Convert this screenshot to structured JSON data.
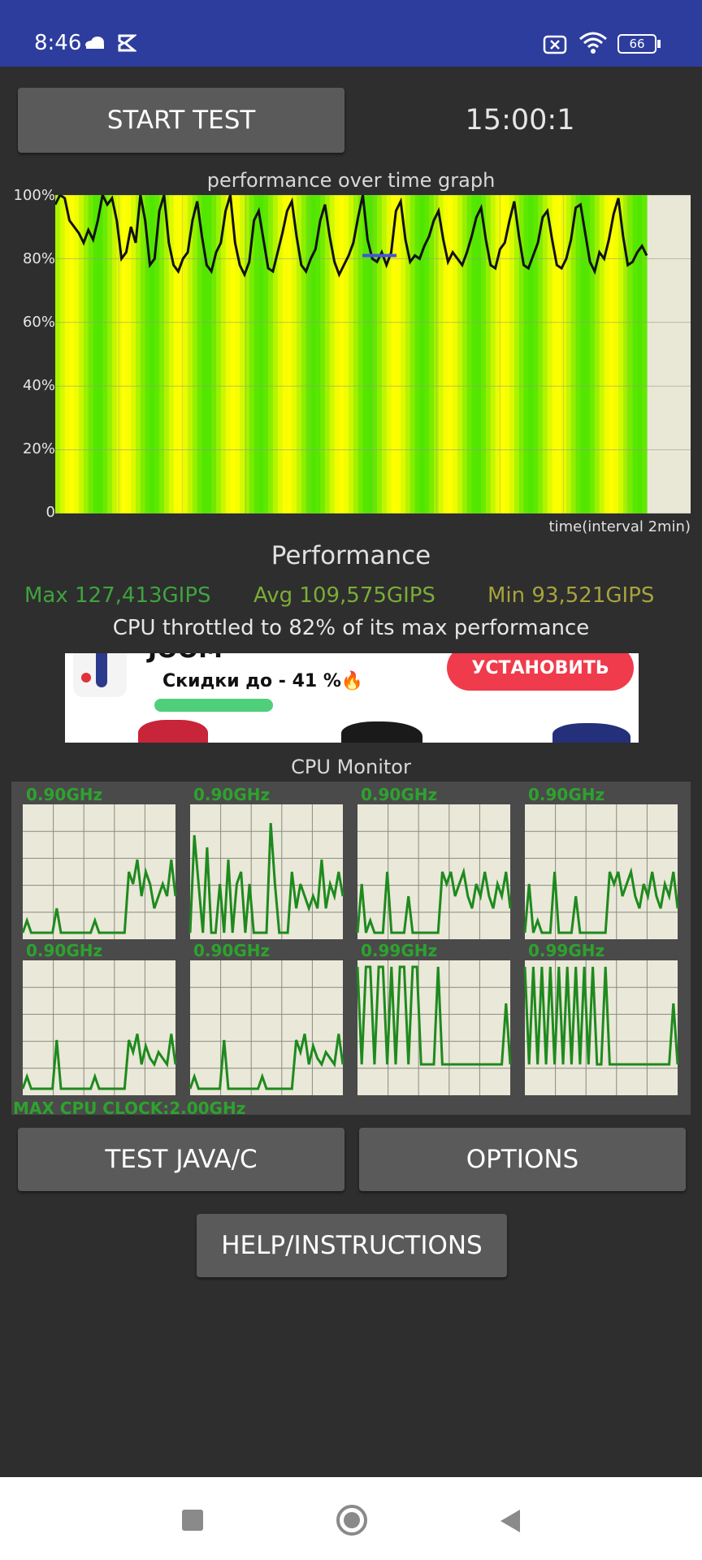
{
  "status_bar": {
    "time": "8:46",
    "battery": "66",
    "icons": [
      "cloud-icon",
      "k-app-icon",
      "sim-off-icon",
      "wifi-icon",
      "battery-icon"
    ]
  },
  "toolbar": {
    "start_label": "START TEST",
    "timer": "15:00:1"
  },
  "perf_graph": {
    "title": "performance over time graph",
    "xlabel": "time(interval 2min)",
    "y_ticks": [
      "100%",
      "80%",
      "60%",
      "40%",
      "20%",
      "0"
    ]
  },
  "chart_data": {
    "type": "line",
    "title": "performance over time graph",
    "xlabel": "time(interval 2min)",
    "ylabel": "",
    "ylim": [
      0,
      100
    ],
    "y_ticks": [
      "0",
      "20%",
      "40%",
      "60%",
      "80%",
      "100%"
    ],
    "grid": true,
    "series": [
      {
        "values": [
          97,
          100,
          99,
          92,
          90,
          88,
          85,
          89,
          86,
          92,
          100,
          97,
          99,
          92,
          80,
          82,
          90,
          85,
          100,
          92,
          78,
          80,
          95,
          100,
          85,
          78,
          76,
          80,
          82,
          92,
          98,
          87,
          78,
          76,
          82,
          85,
          95,
          100,
          85,
          78,
          75,
          79,
          92,
          95,
          86,
          77,
          76,
          82,
          88,
          95,
          98,
          87,
          78,
          76,
          80,
          83,
          92,
          97,
          87,
          79,
          75,
          78,
          81,
          85,
          93,
          100,
          86,
          80,
          79,
          82,
          78,
          82,
          95,
          98,
          86,
          79,
          81,
          80,
          84,
          87,
          92,
          95,
          86,
          79,
          82,
          80,
          78,
          82,
          87,
          93,
          96,
          86,
          78,
          77,
          83,
          85,
          92,
          98,
          87,
          78,
          77,
          81,
          85,
          93,
          95,
          86,
          78,
          77,
          80,
          86,
          96,
          97,
          88,
          79,
          76,
          82,
          80,
          86,
          94,
          99,
          87,
          78,
          79,
          82,
          84,
          81
        ]
      }
    ]
  },
  "performance": {
    "title": "Performance",
    "max": "Max 127,413GIPS",
    "avg": "Avg 109,575GIPS",
    "min": "Min 93,521GIPS",
    "throttle": "CPU throttled to 82% of its max performance"
  },
  "ad": {
    "text_top": "JOOM",
    "text": "Скидки до - 41 %🔥",
    "button": "УСТАНОВИТЬ"
  },
  "cpu_monitor": {
    "title": "CPU Monitor",
    "cores": [
      {
        "freq": "0.90GHz",
        "values": [
          0,
          10,
          0,
          0,
          0,
          0,
          0,
          0,
          20,
          0,
          0,
          0,
          0,
          0,
          0,
          0,
          0,
          10,
          0,
          0,
          0,
          0,
          0,
          0,
          0,
          50,
          40,
          60,
          30,
          50,
          40,
          20,
          30,
          40,
          30,
          60,
          30
        ]
      },
      {
        "freq": "0.90GHz",
        "values": [
          0,
          80,
          40,
          0,
          70,
          0,
          0,
          40,
          0,
          60,
          0,
          40,
          50,
          0,
          40,
          0,
          0,
          0,
          0,
          90,
          40,
          0,
          0,
          0,
          50,
          20,
          40,
          30,
          20,
          30,
          20,
          60,
          20,
          40,
          30,
          50,
          30
        ]
      },
      {
        "freq": "0.90GHz",
        "values": [
          0,
          40,
          0,
          10,
          0,
          0,
          0,
          50,
          0,
          0,
          0,
          0,
          30,
          0,
          0,
          0,
          0,
          0,
          0,
          0,
          50,
          40,
          50,
          30,
          40,
          50,
          30,
          20,
          40,
          30,
          50,
          30,
          20,
          40,
          30,
          50,
          20
        ]
      },
      {
        "freq": "0.90GHz",
        "values": [
          0,
          40,
          0,
          10,
          0,
          0,
          0,
          50,
          0,
          0,
          0,
          0,
          30,
          0,
          0,
          0,
          0,
          0,
          0,
          0,
          50,
          40,
          50,
          30,
          40,
          50,
          30,
          20,
          40,
          30,
          50,
          30,
          20,
          40,
          30,
          50,
          20
        ]
      },
      {
        "freq": "0.90GHz",
        "values": [
          0,
          10,
          0,
          0,
          0,
          0,
          0,
          0,
          40,
          0,
          0,
          0,
          0,
          0,
          0,
          0,
          0,
          10,
          0,
          0,
          0,
          0,
          0,
          0,
          0,
          40,
          30,
          45,
          20,
          35,
          25,
          20,
          30,
          25,
          20,
          45,
          20
        ]
      },
      {
        "freq": "0.90GHz",
        "values": [
          0,
          10,
          0,
          0,
          0,
          0,
          0,
          0,
          40,
          0,
          0,
          0,
          0,
          0,
          0,
          0,
          0,
          10,
          0,
          0,
          0,
          0,
          0,
          0,
          0,
          40,
          30,
          45,
          20,
          35,
          25,
          20,
          30,
          25,
          20,
          45,
          20
        ]
      },
      {
        "freq": "0.99GHz",
        "values": [
          100,
          20,
          100,
          100,
          20,
          100,
          100,
          20,
          100,
          20,
          100,
          100,
          20,
          100,
          100,
          20,
          20,
          20,
          20,
          100,
          20,
          20,
          20,
          20,
          20,
          20,
          20,
          20,
          20,
          20,
          20,
          20,
          20,
          20,
          20,
          70,
          20
        ]
      },
      {
        "freq": "0.99GHz",
        "values": [
          100,
          20,
          100,
          20,
          100,
          20,
          100,
          20,
          100,
          20,
          100,
          20,
          100,
          20,
          100,
          20,
          100,
          20,
          20,
          100,
          20,
          20,
          20,
          20,
          20,
          20,
          20,
          20,
          20,
          20,
          20,
          20,
          20,
          20,
          20,
          70,
          20
        ]
      }
    ],
    "max_clock": "MAX CPU CLOCK:2.00GHz"
  },
  "buttons": {
    "test_java": "TEST JAVA/C",
    "options": "OPTIONS",
    "help": "HELP/INSTRUCTIONS"
  },
  "nav": {
    "icons": [
      "recents-icon",
      "home-icon",
      "back-icon"
    ]
  }
}
